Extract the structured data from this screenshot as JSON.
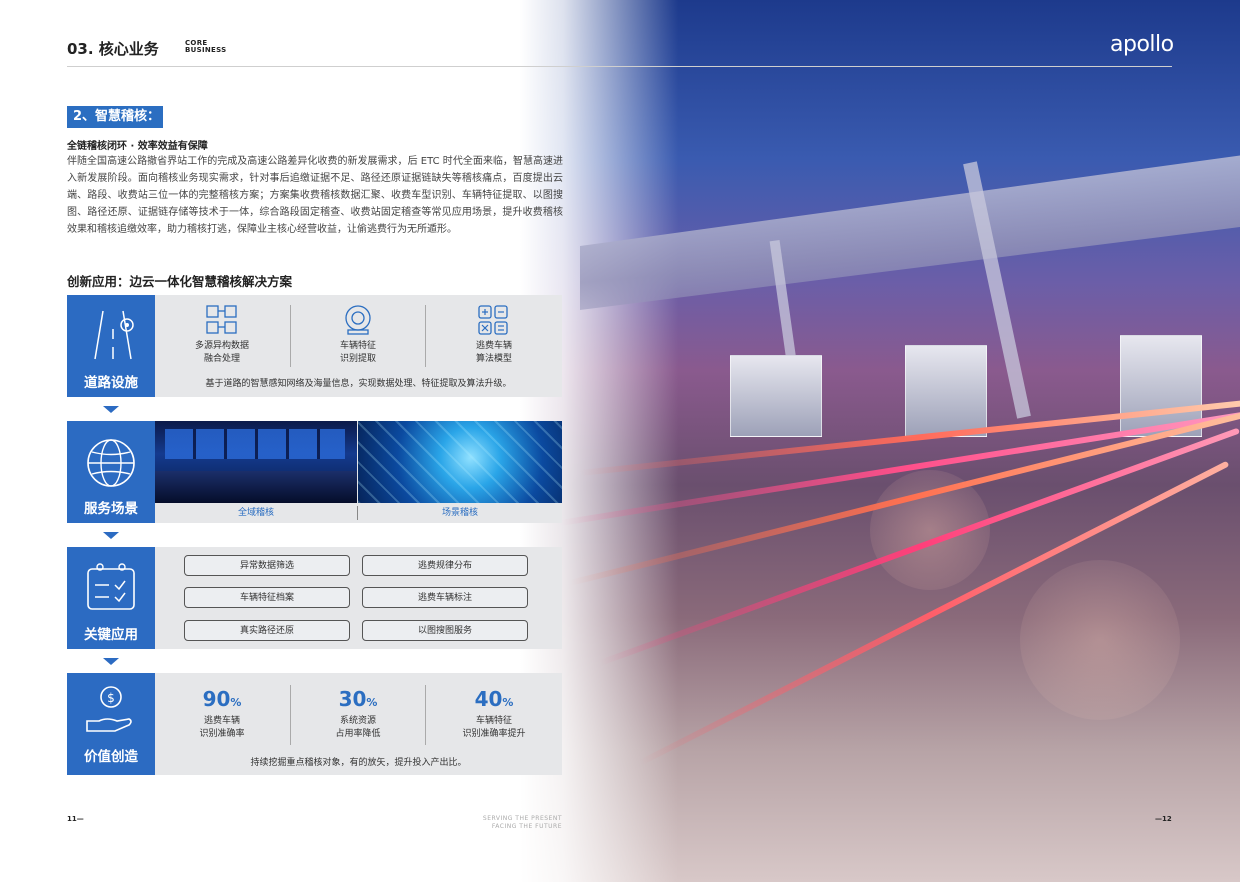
{
  "header": {
    "section_title": "03. 核心业务",
    "sub_en_line1": "CORE",
    "sub_en_line2": "BUSINESS",
    "logo": "apollo"
  },
  "section": {
    "badge": "2、智慧稽核：",
    "subhead": "全链稽核闭环 · 效率效益有保障",
    "paragraph": "伴随全国高速公路撤省界站工作的完成及高速公路差异化收费的新发展需求，后 ETC 时代全面来临，智慧高速进入新发展阶段。面向稽核业务现实需求，针对事后追缴证据不足、路径还原证据链缺失等稽核痛点，百度提出云端、路段、收费站三位一体的完整稽核方案；方案集收费稽核数据汇聚、收费车型识别、车辆特征提取、以图搜图、路径还原、证据链存储等技术于一体，综合路段固定稽查、收费站固定稽查等常见应用场景，提升收费稽核效果和稽核追缴效率，助力稽核打逃，保障业主核心经营收益，让偷逃费行为无所遁形。",
    "innovation_title": "创新应用：边云一体化智慧稽核解决方案"
  },
  "rows": {
    "road": {
      "label": "道路设施",
      "features": [
        {
          "icon": "grid-blocks-icon",
          "line1": "多源异构数据",
          "line2": "融合处理"
        },
        {
          "icon": "camera-icon",
          "line1": "车辆特征",
          "line2": "识别提取"
        },
        {
          "icon": "calculator-icon",
          "line1": "逃费车辆",
          "line2": "算法模型"
        }
      ],
      "note": "基于道路的智慧感知网络及海量信息，实现数据处理、特征提取及算法升级。"
    },
    "service": {
      "label": "服务场景",
      "captions": [
        "全域稽核",
        "场景稽核"
      ]
    },
    "apps": {
      "label": "关键应用",
      "items": [
        "异常数据筛选",
        "逃费规律分布",
        "车辆特征档案",
        "逃费车辆标注",
        "真实路径还原",
        "以图搜图服务"
      ]
    },
    "value": {
      "label": "价值创造",
      "stats": [
        {
          "num": "90",
          "unit": "%",
          "line1": "逃费车辆",
          "line2": "识别准确率"
        },
        {
          "num": "30",
          "unit": "%",
          "line1": "系统资源",
          "line2": "占用率降低"
        },
        {
          "num": "40",
          "unit": "%",
          "line1": "车辆特征",
          "line2": "识别准确率提升"
        }
      ],
      "note": "持续挖掘重点稽核对象，有的放矢，提升投入产出比。"
    }
  },
  "footer": {
    "page_left": "11",
    "page_right": "12",
    "slogan_line1": "SERVING THE PRESENT",
    "slogan_line2": "FACING THE FUTURE"
  },
  "colors": {
    "accent": "#2b6ec1",
    "panel": "#e6e7e9"
  }
}
